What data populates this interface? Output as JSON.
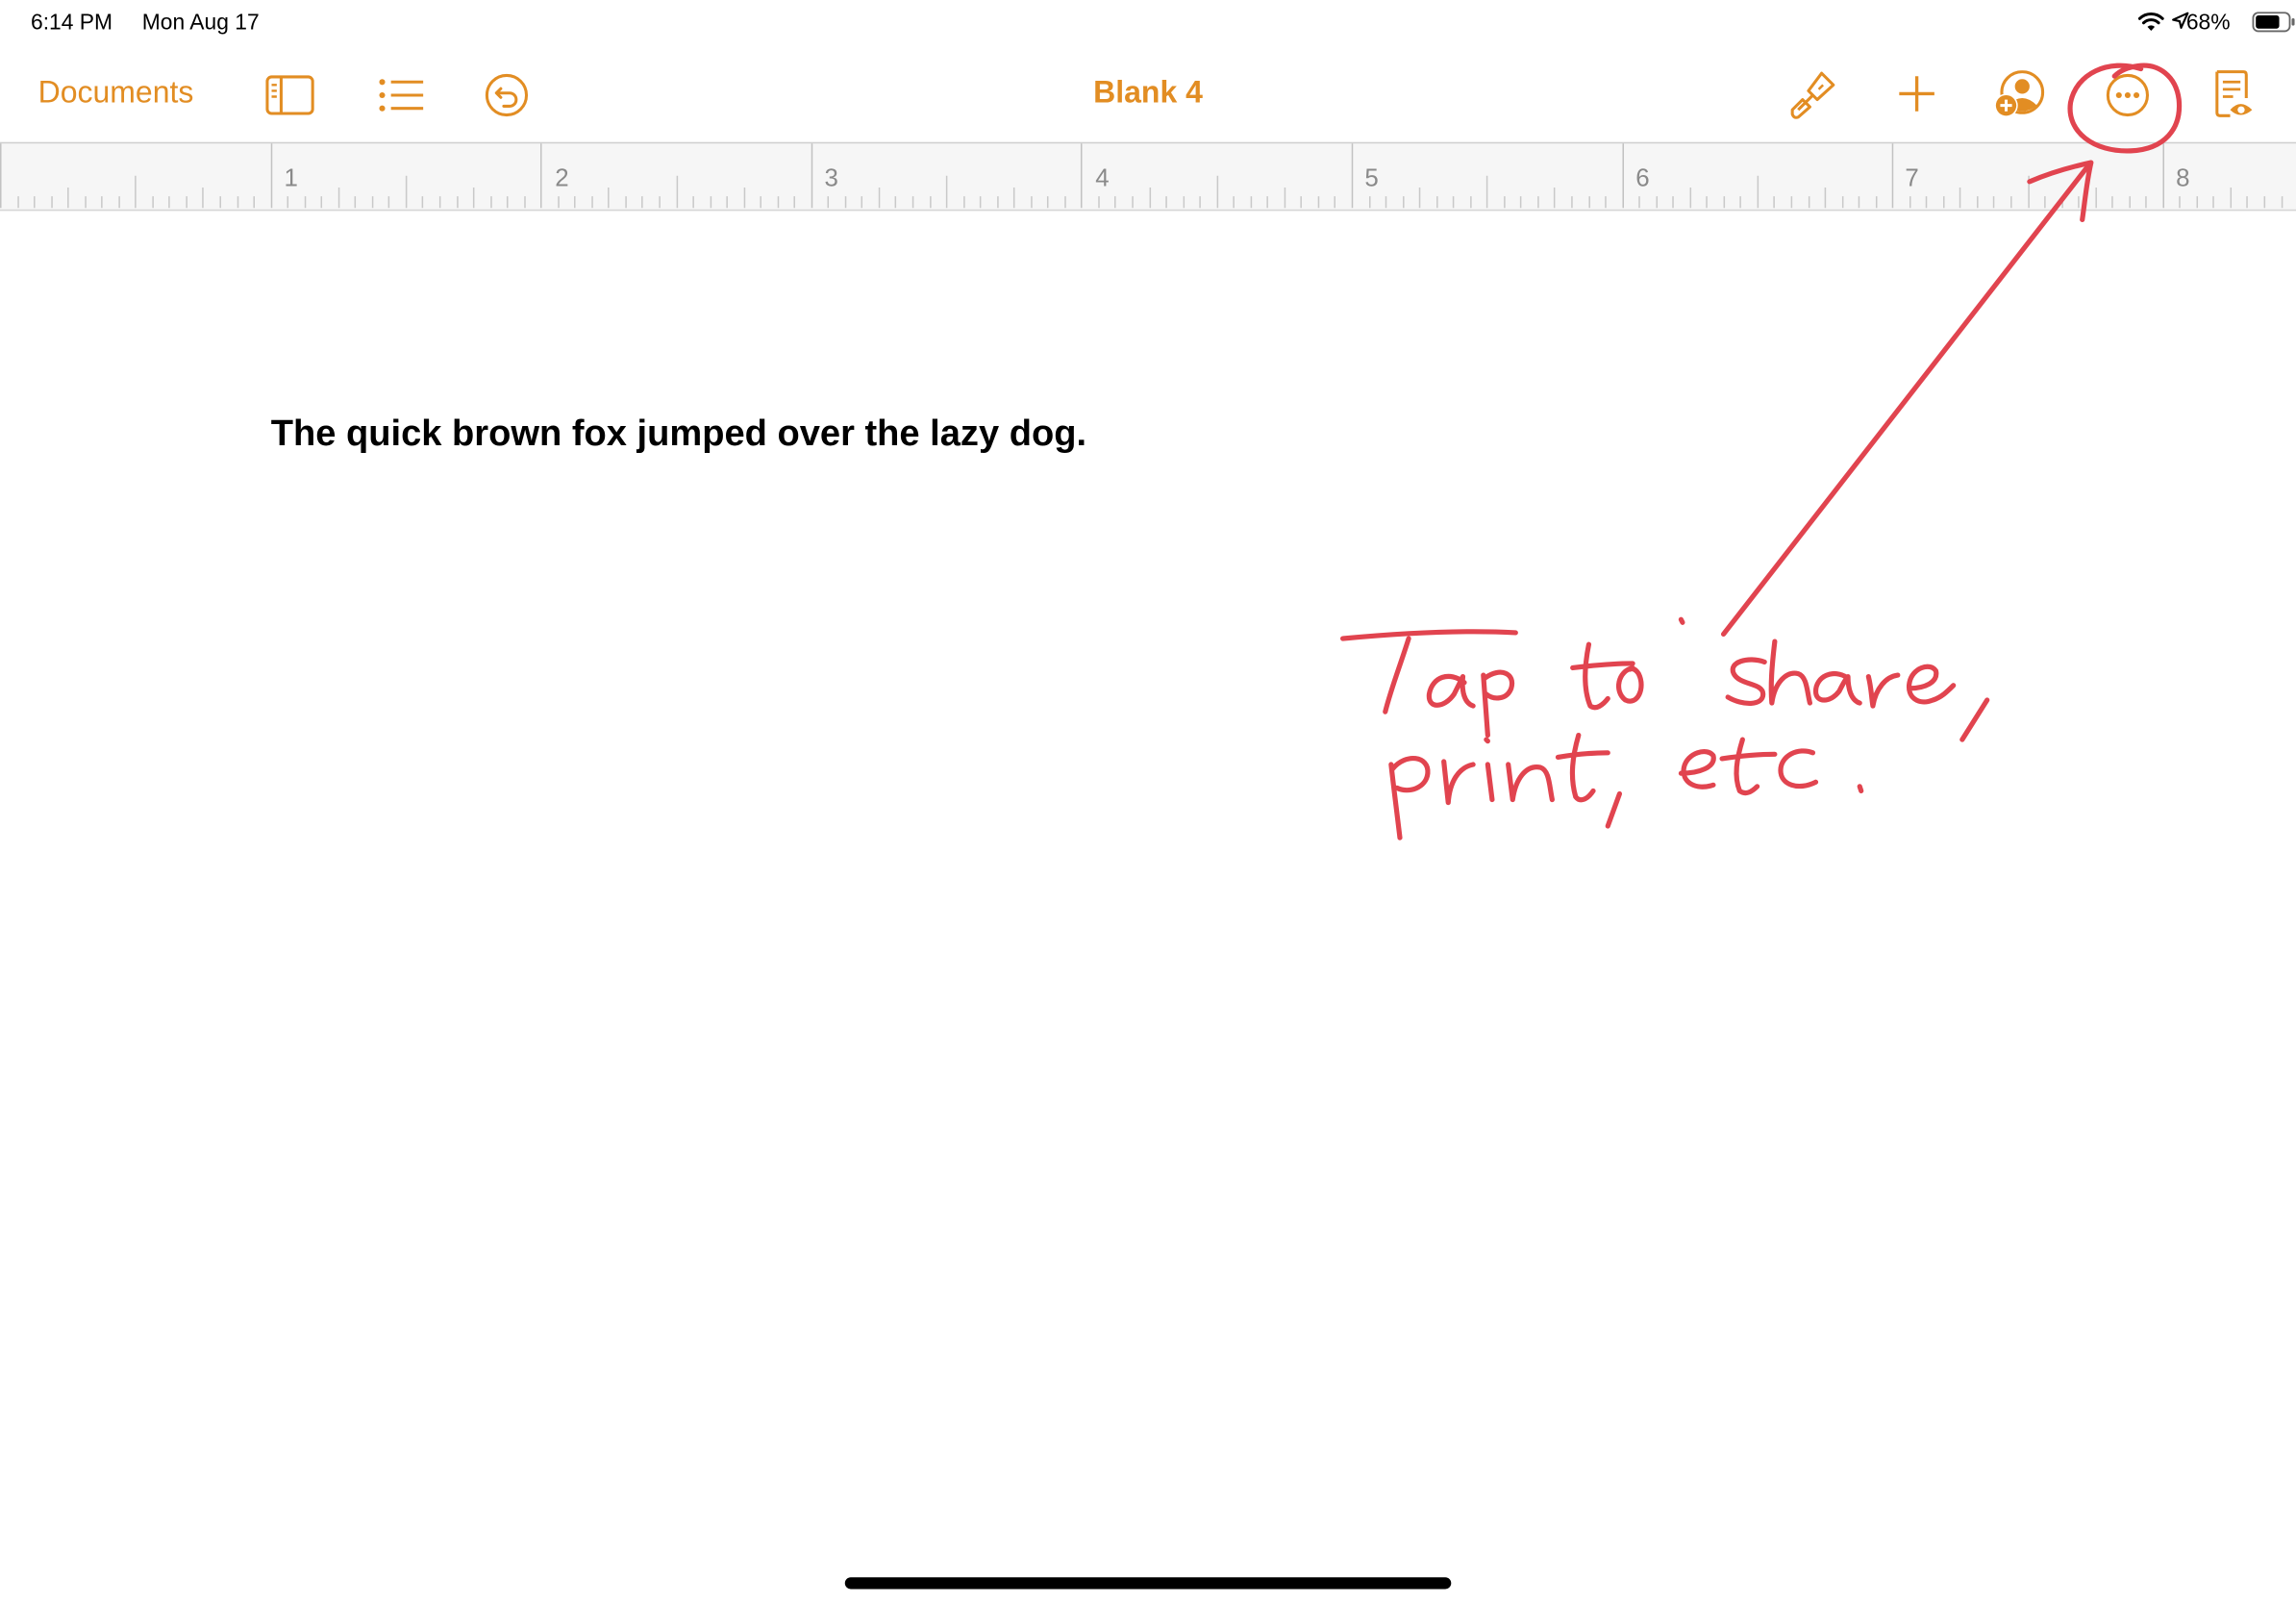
{
  "status_bar": {
    "time": "6:14 PM",
    "date": "Mon Aug 17",
    "battery": "68%"
  },
  "toolbar": {
    "documents_label": "Documents",
    "title": "Blank 4",
    "icons": [
      "sidebar-icon",
      "list-icon",
      "undo-icon",
      "paintbrush-icon",
      "plus-icon",
      "collaborate-icon",
      "more-icon",
      "reading-view-icon"
    ]
  },
  "ruler": {
    "numbers": [
      "1",
      "2",
      "3",
      "4",
      "5",
      "6",
      "7",
      "8"
    ]
  },
  "document": {
    "text": "The quick brown fox jumped over the lazy dog."
  },
  "annotation": {
    "line1": "Tap to share,",
    "line2": "print, etc."
  },
  "colors": {
    "accent": "#e28d23",
    "annotation": "#e1444f"
  }
}
